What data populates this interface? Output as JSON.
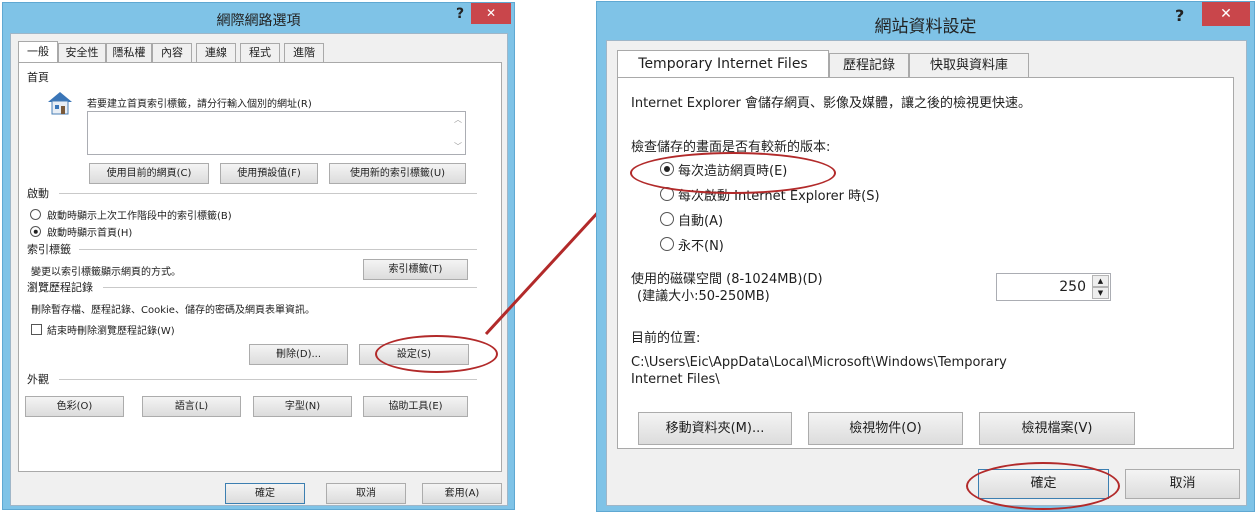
{
  "left": {
    "title": "網際網路選項",
    "help": "?",
    "close": "✕",
    "tabs": [
      "一般",
      "安全性",
      "隱私權",
      "內容",
      "連線",
      "程式",
      "進階"
    ],
    "homepage": {
      "section": "首頁",
      "icon": "house-icon",
      "desc": "若要建立首頁索引標籤，請分行輸入個別的網址(R)",
      "url_value": "",
      "btn_current": "使用目前的網頁(C)",
      "btn_default": "使用預設值(F)",
      "btn_newtab": "使用新的索引標籤(U)"
    },
    "startup": {
      "section": "啟動",
      "opt_last": "啟動時顯示上次工作階段中的索引標籤(B)",
      "opt_home": "啟動時顯示首頁(H)"
    },
    "tabs_section": {
      "section": "索引標籤",
      "desc": "變更以索引標籤顯示網頁的方式。",
      "btn": "索引標籤(T)"
    },
    "history": {
      "section": "瀏覽歷程記錄",
      "desc": "刪除暫存檔、歷程記錄、Cookie、儲存的密碼及網頁表單資訊。",
      "check_label": "結束時刪除瀏覽歷程記錄(W)",
      "btn_delete": "刪除(D)...",
      "btn_settings": "設定(S)"
    },
    "appearance": {
      "section": "外觀",
      "btn_colors": "色彩(O)",
      "btn_languages": "語言(L)",
      "btn_fonts": "字型(N)",
      "btn_access": "協助工具(E)"
    },
    "footer": {
      "ok": "確定",
      "cancel": "取消",
      "apply": "套用(A)"
    }
  },
  "right": {
    "title": "網站資料設定",
    "help": "?",
    "close": "✕",
    "tabs": [
      "Temporary Internet Files",
      "歷程記錄",
      "快取與資料庫"
    ],
    "intro": "Internet Explorer 會儲存網頁、影像及媒體，讓之後的檢視更快速。",
    "check_label": "檢查儲存的畫面是否有較新的版本:",
    "options": [
      "每次造訪網頁時(E)",
      "每次啟動 Internet Explorer 時(S)",
      "自動(A)",
      "永不(N)"
    ],
    "selected_option": 0,
    "disk_label_1": "使用的磁碟空間 (8-1024MB)(D)",
    "disk_label_2": "(建議大小:50-250MB)",
    "disk_value": "250",
    "location_label": "目前的位置:",
    "location_path_1": "C:\\Users\\Eic\\AppData\\Local\\Microsoft\\Windows\\Temporary",
    "location_path_2": "Internet Files\\",
    "btn_move": "移動資料夾(M)...",
    "btn_view_objects": "檢視物件(O)",
    "btn_view_files": "檢視檔案(V)",
    "ok": "確定",
    "cancel": "取消"
  },
  "colors": {
    "title_bar": "#7fc3e7",
    "close_button": "#c9464b",
    "highlight": "#b22a2a"
  }
}
